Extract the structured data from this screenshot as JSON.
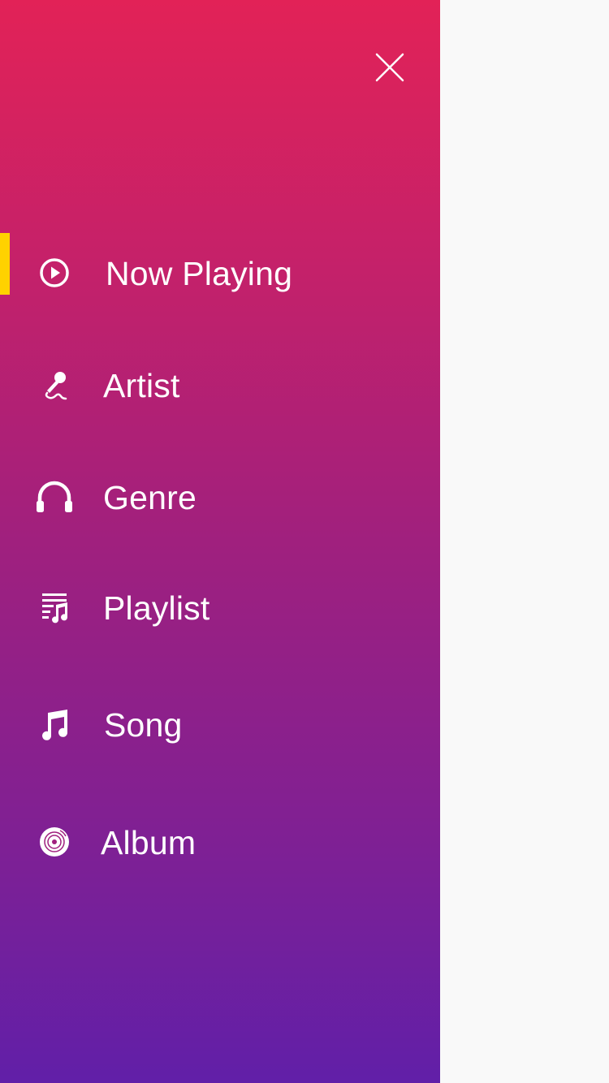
{
  "menu": {
    "accent_color": "#ffd200",
    "gradient_top": "#e22257",
    "gradient_bottom": "#611fa8",
    "close_icon": "close-icon",
    "items": [
      {
        "label": "Now Playing",
        "icon": "play-circle-icon",
        "active": true
      },
      {
        "label": "Artist",
        "icon": "microphone-icon",
        "active": false
      },
      {
        "label": "Genre",
        "icon": "headphones-icon",
        "active": false
      },
      {
        "label": "Playlist",
        "icon": "playlist-icon",
        "active": false
      },
      {
        "label": "Song",
        "icon": "music-note-icon",
        "active": false
      },
      {
        "label": "Album",
        "icon": "vinyl-disc-icon",
        "active": false
      }
    ]
  }
}
